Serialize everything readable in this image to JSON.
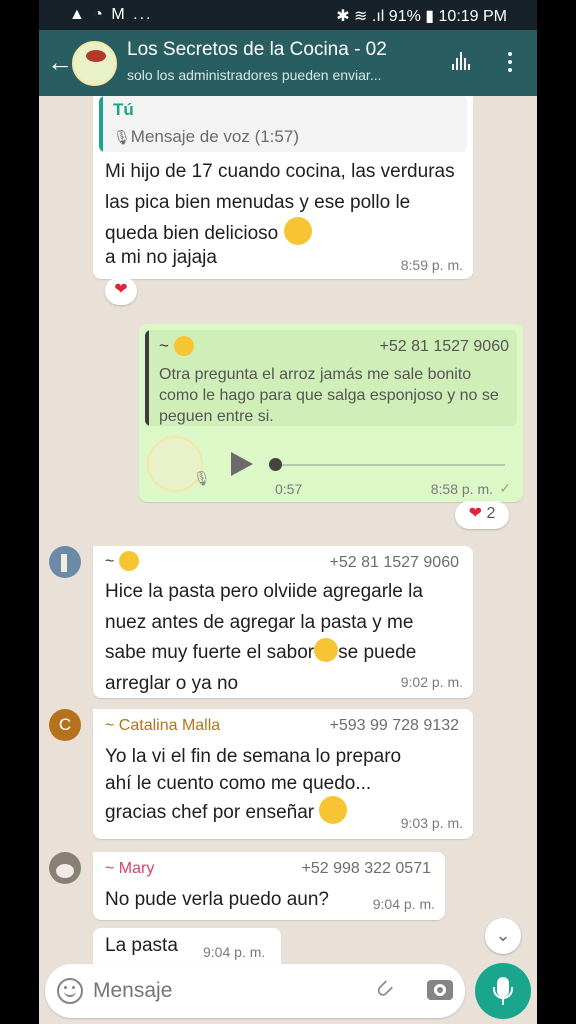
{
  "status_bar": {
    "left": "▲ ◔ M ...",
    "right": "✱ ≋ .ıl 91% ▮ 10:19 PM"
  },
  "header": {
    "title": "Los Secretos de la Cocina - 02",
    "subtitle": "solo los administradores pueden enviar..."
  },
  "messages": {
    "m1": {
      "quote_author": "Tú",
      "quote_text": "Mensaje de voz (1:57)",
      "text": "Mi hijo de 17 cuando cocina, las verduras las pica bien menudas y ese pollo le queda bien delicioso",
      "tail": "a mi no jajaja",
      "time": "8:59 p. m.",
      "reaction": "❤"
    },
    "m2": {
      "quote_author": "~",
      "quote_phone": "+52 81 1527 9060",
      "quote_text": "Otra pregunta el arroz jamás me sale bonito como le hago para que salga esponjoso y no se peguen entre si.",
      "voice_duration": "0:57",
      "time": "8:58 p. m.",
      "tick": "✓",
      "reaction": "❤",
      "reaction_count": "2"
    },
    "m3": {
      "sender": "~",
      "phone": "+52 81 1527 9060",
      "line1": "Hice la pasta pero olviide agregarle la",
      "line2": "nuez antes de agregar la pasta y me",
      "line3a": "sabe muy fuerte el sabor",
      "line3b": "se puede",
      "line4": "arreglar o ya no",
      "time": "9:02 p. m."
    },
    "m4": {
      "avatar_letter": "C",
      "sender": "~ Catalina Malla",
      "phone": "+593 99 728 9132",
      "line1": "Yo la vi el fin de semana lo preparo",
      "line2": "ahí le cuento como me quedo...",
      "line3": "gracias chef por enseñar",
      "time": "9:03 p. m."
    },
    "m5": {
      "sender": "~ Mary",
      "phone": "+52 998 322 0571",
      "text": "No pude verla puedo aun?",
      "time": "9:04 p. m."
    },
    "m6": {
      "text": "La pasta",
      "time": "9:04 p. m."
    }
  },
  "input": {
    "placeholder": "Mensaje"
  },
  "colors": {
    "header": "#285e61",
    "status_bar": "#16212a",
    "chat_bg": "#e9e1d8",
    "outgoing": "#dcf8c6",
    "accent": "#1aa68c",
    "catalina": "#b5721d",
    "mary": "#d6436d"
  },
  "icons": [
    "back-arrow-icon",
    "waveform-icon",
    "more-vert-icon",
    "microphone-icon",
    "play-icon",
    "emoji-icon",
    "attach-icon",
    "camera-icon",
    "scroll-down-icon",
    "heart-icon"
  ]
}
